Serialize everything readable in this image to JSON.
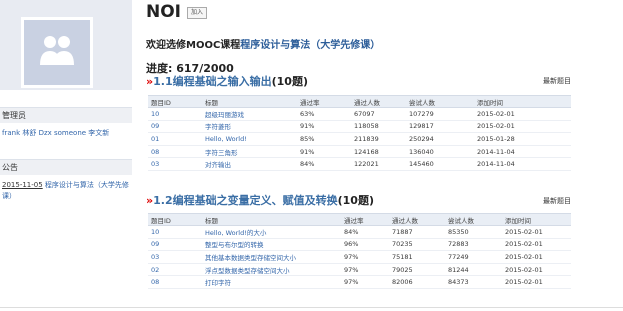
{
  "sidebar": {
    "admins_heading": "管理员",
    "admins": "frank 林舒 Dzx someone 李文新",
    "notice_heading": "公告",
    "notice_date": "2015-11-05",
    "notice_text": "程序设计与算法（大学先修课）"
  },
  "course": {
    "name": "NOI",
    "join_label": "加入",
    "welcome_prefix": "欢迎选修MOOC课程",
    "welcome_link": "程序设计与算法（大学先修课）",
    "progress": "进度: 617/2000"
  },
  "sections": [
    {
      "arrow": "»",
      "title": "1.1编程基础之输入输出",
      "count": "(10题)",
      "newest_label": "最新题目",
      "columns": [
        "题目ID",
        "标题",
        "通过率",
        "通过人数",
        "尝试人数",
        "添加时间"
      ],
      "rows": [
        {
          "id": "10",
          "title": "超级玛丽游戏",
          "rate": "63%",
          "passed": "67097",
          "tried": "107279",
          "date": "2015-02-01"
        },
        {
          "id": "09",
          "title": "字符菱形",
          "rate": "91%",
          "passed": "118058",
          "tried": "129817",
          "date": "2015-02-01"
        },
        {
          "id": "01",
          "title": "Hello, World!",
          "rate": "85%",
          "passed": "211839",
          "tried": "250294",
          "date": "2015-01-28"
        },
        {
          "id": "08",
          "title": "字符三角形",
          "rate": "91%",
          "passed": "124168",
          "tried": "136040",
          "date": "2014-11-04"
        },
        {
          "id": "03",
          "title": "对齐输出",
          "rate": "84%",
          "passed": "122021",
          "tried": "145460",
          "date": "2014-11-04"
        }
      ]
    },
    {
      "arrow": "»",
      "title": "1.2编程基础之变量定义、赋值及转换",
      "count": "(10题)",
      "newest_label": "最新题目",
      "columns": [
        "题目ID",
        "标题",
        "通过率",
        "通过人数",
        "尝试人数",
        "添加时间"
      ],
      "rows": [
        {
          "id": "10",
          "title": "Hello, World!的大小",
          "rate": "84%",
          "passed": "71887",
          "tried": "85350",
          "date": "2015-02-01"
        },
        {
          "id": "09",
          "title": "整型与布尔型的转换",
          "rate": "96%",
          "passed": "70235",
          "tried": "72883",
          "date": "2015-02-01"
        },
        {
          "id": "03",
          "title": "其他基本数据类型存储空间大小",
          "rate": "97%",
          "passed": "75181",
          "tried": "77249",
          "date": "2015-02-01"
        },
        {
          "id": "02",
          "title": "浮点型数据类型存储空间大小",
          "rate": "97%",
          "passed": "79025",
          "tried": "81244",
          "date": "2015-02-01"
        },
        {
          "id": "08",
          "title": "打印字符",
          "rate": "97%",
          "passed": "82006",
          "tried": "84373",
          "date": "2015-02-01"
        }
      ]
    }
  ]
}
